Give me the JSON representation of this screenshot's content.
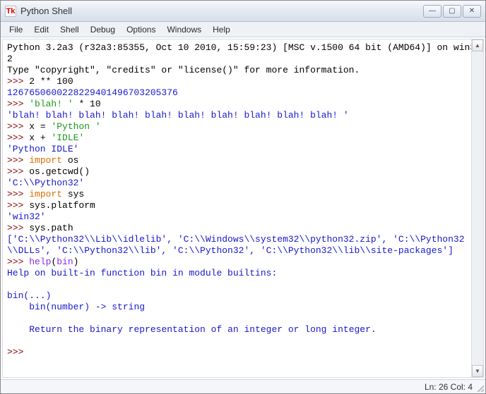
{
  "window": {
    "icon_text": "Tk",
    "title": "Python Shell"
  },
  "menu": {
    "file": "File",
    "edit": "Edit",
    "shell": "Shell",
    "debug": "Debug",
    "options": "Options",
    "windows": "Windows",
    "help": "Help"
  },
  "console": {
    "header1": "Python 3.2a3 (r32a3:85355, Oct 10 2010, 15:59:23) [MSC v.1500 64 bit (AMD64)] on win32",
    "header2": "Type \"copyright\", \"credits\" or \"license()\" for more information.",
    "p": ">>> ",
    "in1": "2 ** 100",
    "out1": "1267650600228229401496703205376",
    "in2a": "'blah! '",
    "in2b": " * 10",
    "out2": "'blah! blah! blah! blah! blah! blah! blah! blah! blah! blah! '",
    "in3a": "x = ",
    "in3b": "'Python '",
    "in4a": "x + ",
    "in4b": "'IDLE'",
    "out4": "'Python IDLE'",
    "in5a": "import",
    "in5b": " os",
    "in6a": "os.getcwd()",
    "out6": "'C:\\\\Python32'",
    "in7a": "import",
    "in7b": " sys",
    "in8": "sys.platform",
    "out8": "'win32'",
    "in9": "sys.path",
    "out9": "['C:\\\\Python32\\\\Lib\\\\idlelib', 'C:\\\\Windows\\\\system32\\\\python32.zip', 'C:\\\\Python32\\\\DLLs', 'C:\\\\Python32\\\\lib', 'C:\\\\Python32', 'C:\\\\Python32\\\\lib\\\\site-packages']",
    "in10a": "help",
    "in10b": "(",
    "in10c": "bin",
    "in10d": ")",
    "out10a": "Help on built-in function bin in module builtins:",
    "out10b": "",
    "out10c": "bin(...)",
    "out10d": "    bin(number) -> string",
    "out10e": "",
    "out10f": "    Return the binary representation of an integer or long integer.",
    "out10g": ""
  },
  "status": {
    "text": "Ln: 26 Col: 4"
  },
  "win_buttons": {
    "min": "—",
    "max": "▢",
    "close": "✕"
  },
  "scroll": {
    "up": "▲",
    "down": "▼"
  }
}
